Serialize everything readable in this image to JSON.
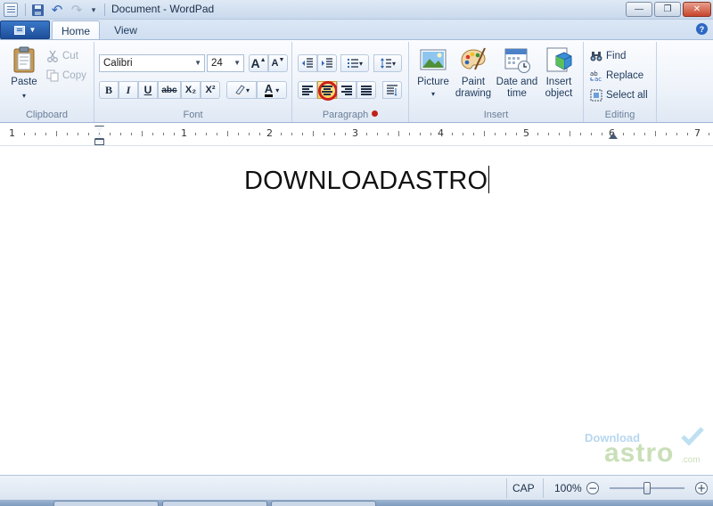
{
  "window": {
    "title": "Document - WordPad",
    "minimize_glyph": "—",
    "maximize_glyph": "❐",
    "close_glyph": "✕"
  },
  "ribbon_tabs": [
    {
      "label": "Home",
      "active": true
    },
    {
      "label": "View",
      "active": false
    }
  ],
  "help_glyph": "?",
  "clipboard": {
    "group_label": "Clipboard",
    "paste_label": "Paste",
    "cut_label": "Cut",
    "copy_label": "Copy"
  },
  "font": {
    "group_label": "Font",
    "family": "Calibri",
    "size": "24",
    "grow_label": "A",
    "shrink_label": "A",
    "bold_label": "B",
    "italic_label": "I",
    "underline_label": "U",
    "strikethrough_label": "abc",
    "subscript_label": "X₂",
    "superscript_label": "X²",
    "text_color_label": "A"
  },
  "paragraph": {
    "group_label": "Paragraph",
    "selected_alignment": "center",
    "highlight_color": "#cc1f1a"
  },
  "insert": {
    "group_label": "Insert",
    "picture_label": "Picture",
    "paint_label_1": "Paint",
    "paint_label_2": "drawing",
    "datetime_label_1": "Date and",
    "datetime_label_2": "time",
    "object_label_1": "Insert",
    "object_label_2": "object"
  },
  "editing": {
    "group_label": "Editing",
    "find_label": "Find",
    "replace_label": "Replace",
    "select_all_label": "Select all"
  },
  "ruler": {
    "numbers": [
      "1",
      "1",
      "2",
      "3",
      "4",
      "5",
      "6",
      "7"
    ]
  },
  "document": {
    "text": "DOWNLOADASTRO"
  },
  "watermark": {
    "top": "Download",
    "brand": "astro",
    "suffix": ".com"
  },
  "status": {
    "caps": "CAP",
    "zoom": "100%",
    "zoom_out_glyph": "−",
    "zoom_in_glyph": "+"
  }
}
